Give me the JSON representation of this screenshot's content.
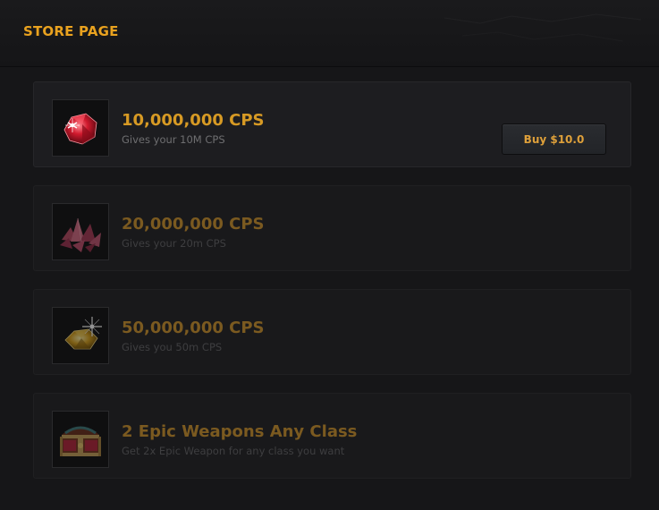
{
  "header": {
    "title": "STORE PAGE"
  },
  "items": [
    {
      "title": "10,000,000 CPS",
      "description": "Gives your 10M CPS",
      "icon": "red-gem-icon",
      "buy_label": "Buy $10.0"
    },
    {
      "title": "20,000,000 CPS",
      "description": "Gives your 20m CPS",
      "icon": "crystal-cluster-icon"
    },
    {
      "title": "50,000,000 CPS",
      "description": "Gives you 50m CPS",
      "icon": "gold-gem-icon"
    },
    {
      "title": "2 Epic Weapons Any Class",
      "description": "Get 2x Epic Weapon for any class you want",
      "icon": "treasure-chest-icon"
    }
  ],
  "colors": {
    "accent": "#e9a21f",
    "title_active": "#d79a24",
    "title_dim": "#7b5a20",
    "background": "#161618"
  }
}
